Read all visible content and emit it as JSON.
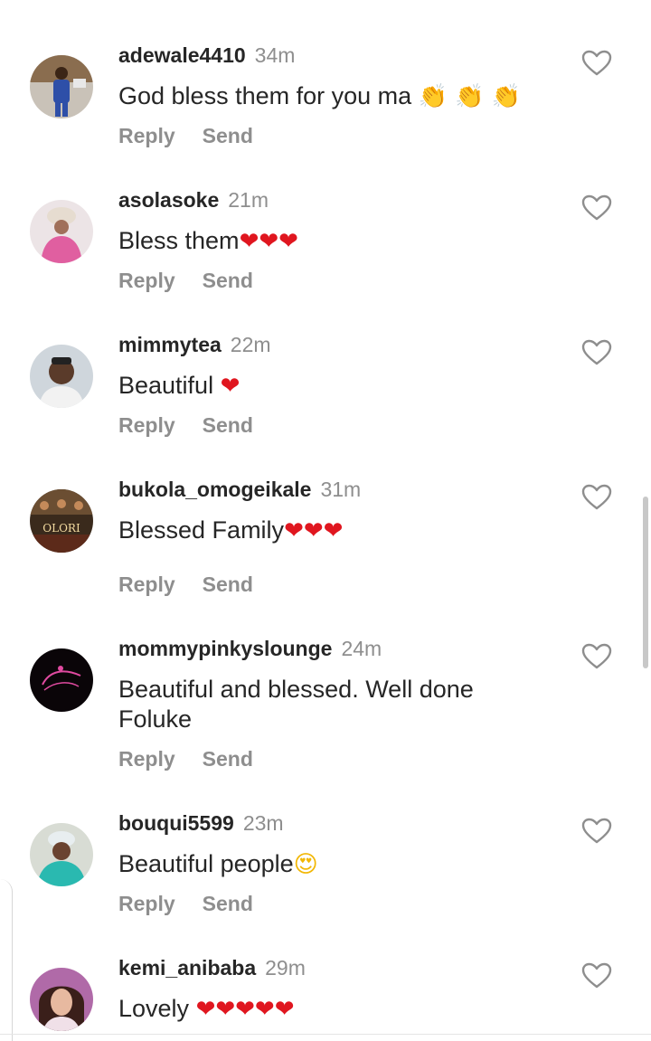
{
  "comments": [
    {
      "username": "adewale4410",
      "time": "34m",
      "text": "God bless them for you ma ",
      "emoji": "👏 👏 👏",
      "emoji_kind": "clap",
      "reply": "Reply",
      "send": "Send"
    },
    {
      "username": "asolasoke",
      "time": "21m",
      "text": "Bless them",
      "emoji": "❤❤❤",
      "emoji_kind": "heart",
      "reply": "Reply",
      "send": "Send"
    },
    {
      "username": "mimmytea",
      "time": "22m",
      "text": "Beautiful ",
      "emoji": "❤",
      "emoji_kind": "heart",
      "reply": "Reply",
      "send": "Send"
    },
    {
      "username": "bukola_omogeikale",
      "time": "31m",
      "text": "Blessed Family",
      "emoji": "❤❤❤",
      "emoji_kind": "heart",
      "reply": "Reply",
      "send": "Send",
      "avatar_text": "OLORI"
    },
    {
      "username": "mommypinkyslounge",
      "time": "24m",
      "text": "Beautiful and blessed. Well done Foluke",
      "emoji": "",
      "emoji_kind": "none",
      "reply": "Reply",
      "send": "Send"
    },
    {
      "username": "bouqui5599",
      "time": "23m",
      "text": "Beautiful people",
      "emoji": "😍",
      "emoji_kind": "face",
      "reply": "Reply",
      "send": "Send"
    },
    {
      "username": "kemi_anibaba",
      "time": "29m",
      "text": "Lovely ",
      "emoji": "❤❤❤❤❤",
      "emoji_kind": "heart",
      "reply": "",
      "send": ""
    }
  ],
  "icons": {
    "like": "heart-outline-icon"
  },
  "colors": {
    "username": "#262626",
    "meta": "#8e8e8e",
    "heart_emoji": "#e0161f"
  }
}
